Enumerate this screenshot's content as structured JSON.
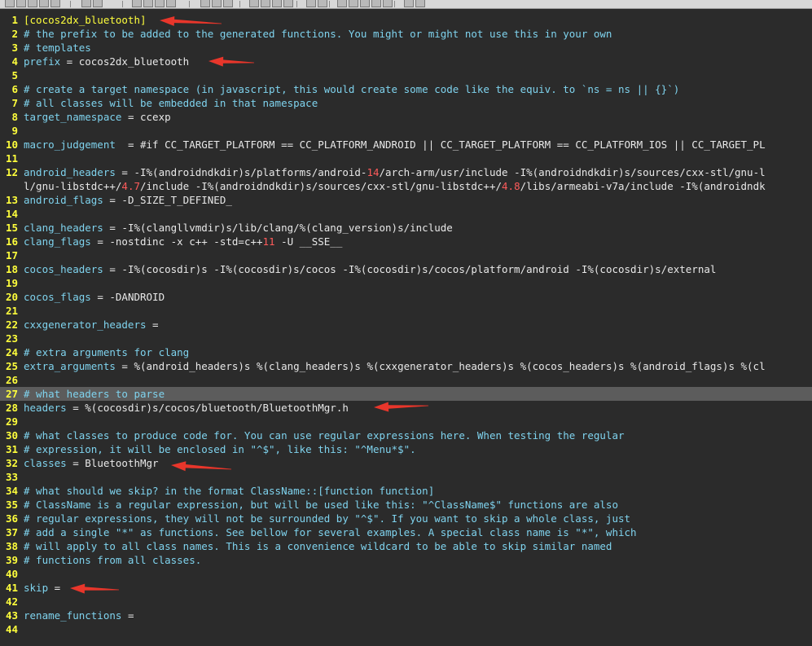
{
  "lines": [
    {
      "n": "1",
      "parts": [
        {
          "t": "[cocos2dx_bluetooth]",
          "c": "sect"
        }
      ]
    },
    {
      "n": "2",
      "parts": [
        {
          "t": "# the prefix to be added to the generated functions. You might or might not use this in your own",
          "c": "cmt"
        }
      ]
    },
    {
      "n": "3",
      "parts": [
        {
          "t": "# templates",
          "c": "cmt"
        }
      ]
    },
    {
      "n": "4",
      "parts": [
        {
          "t": "prefix",
          "c": "key"
        },
        {
          "t": " = cocos2dx_bluetooth",
          "c": "val"
        }
      ]
    },
    {
      "n": "5",
      "parts": []
    },
    {
      "n": "6",
      "parts": [
        {
          "t": "# create a target namespace (in javascript, this would create some code like the equiv. to `ns = ns || {}`)",
          "c": "cmt"
        }
      ]
    },
    {
      "n": "7",
      "parts": [
        {
          "t": "# all classes will be embedded in that namespace",
          "c": "cmt"
        }
      ]
    },
    {
      "n": "8",
      "parts": [
        {
          "t": "target_namespace",
          "c": "key"
        },
        {
          "t": " = ccexp",
          "c": "val"
        }
      ]
    },
    {
      "n": "9",
      "parts": []
    },
    {
      "n": "10",
      "parts": [
        {
          "t": "macro_judgement",
          "c": "key"
        },
        {
          "t": "  = #if CC_TARGET_PLATFORM == CC_PLATFORM_ANDROID || CC_TARGET_PLATFORM == CC_PLATFORM_IOS || CC_TARGET_PL",
          "c": "val"
        }
      ]
    },
    {
      "n": "11",
      "parts": []
    },
    {
      "n": "12",
      "parts": [
        {
          "t": "android_headers",
          "c": "key"
        },
        {
          "t": " = -I%(androidndkdir)s/platforms/android-",
          "c": "val"
        },
        {
          "t": "14",
          "c": "num"
        },
        {
          "t": "/arch-arm/usr/include -I%(androidndkdir)s/sources/cxx-stl/gnu-l",
          "c": "val"
        }
      ]
    },
    {
      "n": "",
      "parts": [
        {
          "t": "l/gnu-libstdc++/",
          "c": "val"
        },
        {
          "t": "4.7",
          "c": "num"
        },
        {
          "t": "/include -I%(androidndkdir)s/sources/cxx-stl/gnu-libstdc++/",
          "c": "val"
        },
        {
          "t": "4.8",
          "c": "num"
        },
        {
          "t": "/libs/armeabi-v7a/include -I%(androidndk",
          "c": "val"
        }
      ]
    },
    {
      "n": "13",
      "parts": [
        {
          "t": "android_flags",
          "c": "key"
        },
        {
          "t": " = -D_SIZE_T_DEFINED_",
          "c": "val"
        }
      ]
    },
    {
      "n": "14",
      "parts": []
    },
    {
      "n": "15",
      "parts": [
        {
          "t": "clang_headers",
          "c": "key"
        },
        {
          "t": " = -I%(clangllvmdir)s/lib/clang/%(clang_version)s/include",
          "c": "val"
        }
      ]
    },
    {
      "n": "16",
      "parts": [
        {
          "t": "clang_flags",
          "c": "key"
        },
        {
          "t": " = -nostdinc -x c++ -std=c++",
          "c": "val"
        },
        {
          "t": "11",
          "c": "num"
        },
        {
          "t": " -U __SSE__",
          "c": "val"
        }
      ]
    },
    {
      "n": "17",
      "parts": []
    },
    {
      "n": "18",
      "parts": [
        {
          "t": "cocos_headers",
          "c": "key"
        },
        {
          "t": " = -I%(cocosdir)s -I%(cocosdir)s/cocos -I%(cocosdir)s/cocos/platform/android -I%(cocosdir)s/external",
          "c": "val"
        }
      ]
    },
    {
      "n": "19",
      "parts": []
    },
    {
      "n": "20",
      "parts": [
        {
          "t": "cocos_flags",
          "c": "key"
        },
        {
          "t": " = -DANDROID",
          "c": "val"
        }
      ]
    },
    {
      "n": "21",
      "parts": []
    },
    {
      "n": "22",
      "parts": [
        {
          "t": "cxxgenerator_headers",
          "c": "key"
        },
        {
          "t": " =",
          "c": "val"
        }
      ]
    },
    {
      "n": "23",
      "parts": []
    },
    {
      "n": "24",
      "parts": [
        {
          "t": "# extra arguments for clang",
          "c": "cmt"
        }
      ]
    },
    {
      "n": "25",
      "parts": [
        {
          "t": "extra_arguments",
          "c": "key"
        },
        {
          "t": " = %(android_headers)s %(clang_headers)s %(cxxgenerator_headers)s %(cocos_headers)s %(android_flags)s %(cl",
          "c": "val"
        }
      ]
    },
    {
      "n": "26",
      "parts": []
    },
    {
      "n": "27",
      "cursor": true,
      "parts": [
        {
          "t": "# what headers to parse",
          "c": "cmt"
        }
      ]
    },
    {
      "n": "28",
      "parts": [
        {
          "t": "headers",
          "c": "key"
        },
        {
          "t": " = %(cocosdir)s/cocos/bluetooth/BluetoothMgr.h",
          "c": "val"
        }
      ]
    },
    {
      "n": "29",
      "parts": []
    },
    {
      "n": "30",
      "parts": [
        {
          "t": "# what classes to produce code for. You can use regular expressions here. When testing the regular",
          "c": "cmt"
        }
      ]
    },
    {
      "n": "31",
      "parts": [
        {
          "t": "# expression, it will be enclosed in \"^$\", like this: \"^Menu*$\".",
          "c": "cmt"
        }
      ]
    },
    {
      "n": "32",
      "parts": [
        {
          "t": "classes",
          "c": "key"
        },
        {
          "t": " = BluetoothMgr",
          "c": "val"
        }
      ]
    },
    {
      "n": "33",
      "parts": []
    },
    {
      "n": "34",
      "parts": [
        {
          "t": "# what should we skip? in the format ClassName::[function function]",
          "c": "cmt"
        }
      ]
    },
    {
      "n": "35",
      "parts": [
        {
          "t": "# ClassName is a regular expression, but will be used like this: \"^ClassName$\" functions are also",
          "c": "cmt"
        }
      ]
    },
    {
      "n": "36",
      "parts": [
        {
          "t": "# regular expressions, they will not be surrounded by \"^$\". If you want to skip a whole class, just",
          "c": "cmt"
        }
      ]
    },
    {
      "n": "37",
      "parts": [
        {
          "t": "# add a single \"*\" as functions. See bellow for several examples. A special class name is \"*\", which",
          "c": "cmt"
        }
      ]
    },
    {
      "n": "38",
      "parts": [
        {
          "t": "# will apply to all class names. This is a convenience wildcard to be able to skip similar named",
          "c": "cmt"
        }
      ]
    },
    {
      "n": "39",
      "parts": [
        {
          "t": "# functions from all classes.",
          "c": "cmt"
        }
      ]
    },
    {
      "n": "40",
      "parts": []
    },
    {
      "n": "41",
      "parts": [
        {
          "t": "skip",
          "c": "key"
        },
        {
          "t": " =",
          "c": "val"
        }
      ]
    },
    {
      "n": "42",
      "parts": []
    },
    {
      "n": "43",
      "parts": [
        {
          "t": "rename_functions",
          "c": "key"
        },
        {
          "t": " =",
          "c": "val"
        }
      ]
    },
    {
      "n": "44",
      "parts": []
    }
  ],
  "arrow_targets": [
    "section-header",
    "prefix",
    "headers",
    "classes",
    "skip"
  ],
  "colors": {
    "background": "#2b2b2b",
    "line_number": "#ffff3c",
    "comment": "#7fd3ee",
    "key": "#7fd3ee",
    "text": "#e8e8e8",
    "number": "#ff5b5b",
    "cursor_line": "#5c5c5c",
    "annotation_arrow": "#e8362b"
  }
}
